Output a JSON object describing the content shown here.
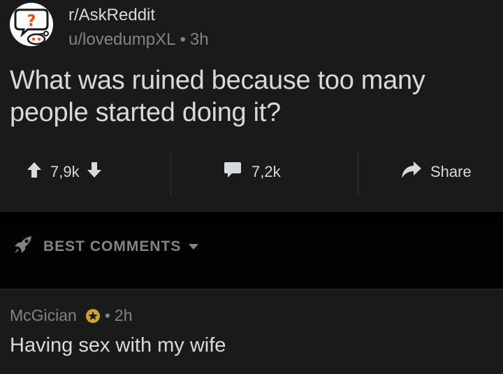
{
  "post": {
    "subreddit": "r/AskReddit",
    "author": "u/lovedumpXL",
    "separator": "•",
    "age": "3h",
    "title": "What was ruined because too many people started doing it?",
    "upvotes": "7,9k",
    "comments": "7,2k",
    "share_label": "Share"
  },
  "sort": {
    "label": "BEST COMMENTS"
  },
  "comment": {
    "author": "McGician",
    "separator": "•",
    "age": "2h",
    "body": "Having sex with my wife"
  },
  "colors": {
    "post_bg": "#1a1a1b",
    "page_bg": "#000000",
    "text": "#d7dadc",
    "muted": "#818384",
    "flair_gold": "#c9a52a",
    "avatar_red": "#ff4500"
  },
  "icons": [
    "askreddit-avatar-icon",
    "upvote-arrow-icon",
    "downvote-arrow-icon",
    "comment-bubble-icon",
    "share-arrow-icon",
    "rocket-icon",
    "chevron-down-icon",
    "star-flair-icon"
  ]
}
